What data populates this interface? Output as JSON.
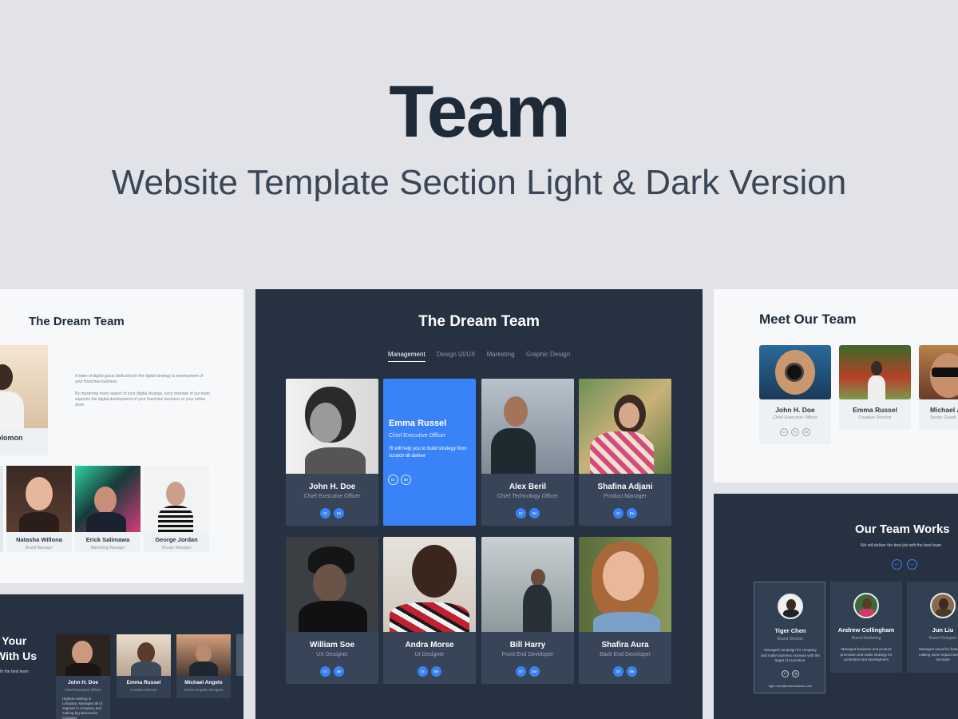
{
  "hero": {
    "title": "Team",
    "subtitle": "Website Template Section Light & Dark Version"
  },
  "colors": {
    "accent": "#3a82f7",
    "dark_panel": "#263142",
    "light_panel": "#f6f8fa",
    "background": "#e1e3e8"
  },
  "left_panel": {
    "title": "The Dream Team",
    "para1": "A team of digital gurus dedicated to the digital strategy & development of your franchise business.",
    "para2": "By mastering every aspect of your digital strategy, each member of our team supports the digital development of your franchise business or your online store.",
    "featured": {
      "name": "Solomon",
      "role": "der"
    },
    "members": [
      {
        "name": "Natasha Willona",
        "role": "Brand Manager"
      },
      {
        "name": "Erick Salimawa",
        "role": "Marketing Manager"
      },
      {
        "name": "George Jordan",
        "role": "Design Manager"
      }
    ]
  },
  "left_dark": {
    "heading1": "t Your",
    "heading2": "With Us",
    "sub": "th the best team",
    "members": [
      {
        "name": "John H. Doe",
        "role": "Chief Executive Officer",
        "desc": "Highest-ranking in company. Managed all of segman in company and making big decisionfor company."
      },
      {
        "name": "Emma Russel",
        "role": "Creative Director"
      },
      {
        "name": "Michael Angelo",
        "role": "Senior Graphic Designer"
      }
    ]
  },
  "center": {
    "title": "The Dream Team",
    "tabs": [
      "Management",
      "Design UI/UX",
      "Marketing",
      "Graphic Design"
    ],
    "social": [
      "Dr",
      "Be"
    ],
    "highlight": {
      "name": "Emma Russel",
      "role": "Chief Executive Officer",
      "desc": "I'll will help you to build strategy from scratch till deliver"
    },
    "members": [
      {
        "name": "John H. Doe",
        "role": "Chief Executive Officer"
      },
      {
        "name": "Alex Beril",
        "role": "Chief Technology Officer"
      },
      {
        "name": "Shafina Adjani",
        "role": "Product Manager"
      },
      {
        "name": "William Soe",
        "role": "UX Designer"
      },
      {
        "name": "Andra Morse",
        "role": "UI Designer"
      },
      {
        "name": "Bill Harry",
        "role": "Front End Developer"
      },
      {
        "name": "Shafira Aura",
        "role": "Back End Developer"
      }
    ]
  },
  "right_panel": {
    "title": "Meet Our Team",
    "social": [
      "Li",
      "Ps",
      "Be"
    ],
    "members": [
      {
        "name": "John H. Doe",
        "role": "Chief Executive Officer"
      },
      {
        "name": "Emma Russel",
        "role": "Creative Director"
      },
      {
        "name": "Michael A",
        "role": "Senior Graph"
      }
    ]
  },
  "right_dark": {
    "title": "Our Team Works",
    "sub": "We will deliver the best job with the best team",
    "social": [
      "Li",
      "Ig"
    ],
    "members": [
      {
        "name": "Tiger Chen",
        "role": "Brand Director",
        "desc": "Managed campaign for company and make business increase with the target of promotion.",
        "email": "tiger.chen@brahamstudio.com"
      },
      {
        "name": "Andrew Collingham",
        "role": "Brand Marketing",
        "desc": "Managed business and product promotion and make strategy for promotion and development"
      },
      {
        "name": "Jun Liu",
        "role": "Brand Designer",
        "desc": "Managed visual for brand and making some impact business increase"
      }
    ]
  }
}
